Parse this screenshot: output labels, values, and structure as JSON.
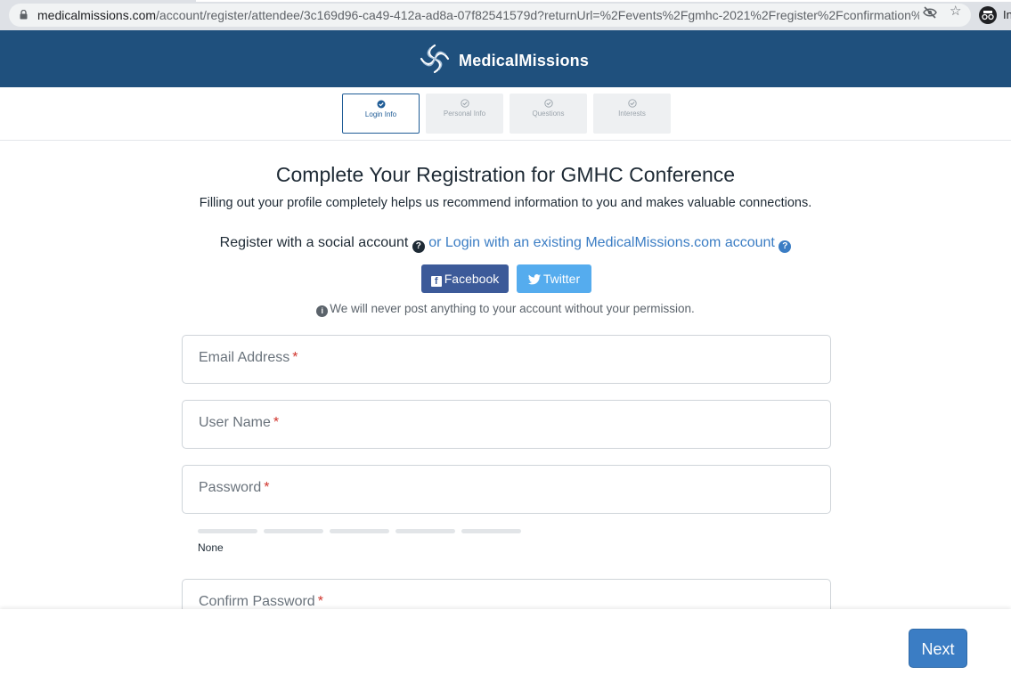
{
  "browser": {
    "url_domain": "medicalmissions.com",
    "url_path": "/account/register/attendee/3c169d96-ca49-412a-ad8a-07f82541579d?returnUrl=%2Fevents%2Fgmhc-2021%2Fregister%2Fconfirmation%...",
    "profile_label": "In"
  },
  "header": {
    "logo_text": "MedicalMissions",
    "background_color": "#1f507d"
  },
  "steps": [
    {
      "label": "Login Info",
      "active": true
    },
    {
      "label": "Personal Info",
      "active": false
    },
    {
      "label": "Questions",
      "active": false
    },
    {
      "label": "Interests",
      "active": false
    }
  ],
  "main": {
    "title": "Complete Your Registration for GMHC Conference",
    "subtitle": "Filling out your profile completely helps us recommend information to you and makes valuable connections.",
    "social_prompt": "Register with a social account",
    "login_link": "or Login with an existing MedicalMissions.com account",
    "facebook_label": "Facebook",
    "twitter_label": "Twitter",
    "permission_note": "We will never post anything to your account without your permission."
  },
  "form": {
    "email_label": "Email Address",
    "username_label": "User Name",
    "password_label": "Password",
    "confirm_password_label": "Confirm Password",
    "required_marker": "*",
    "password_strength": "None"
  },
  "footer": {
    "next_label": "Next"
  }
}
